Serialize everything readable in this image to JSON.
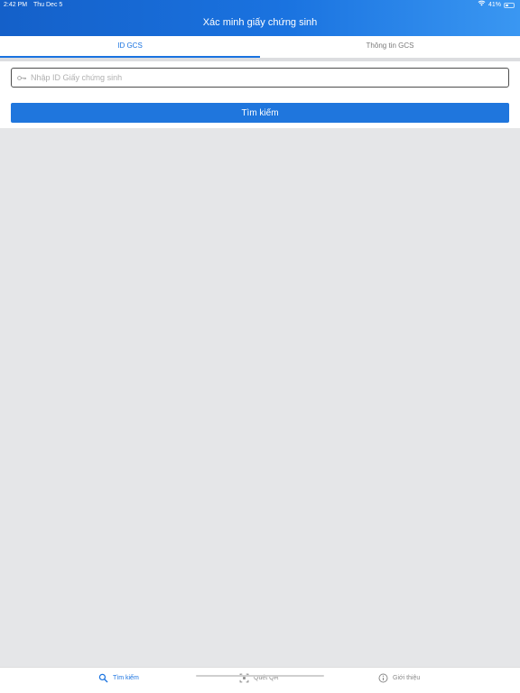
{
  "status_bar": {
    "time": "2:42 PM",
    "date": "Thu Dec 5",
    "battery": "41%",
    "battery_level": 0.41,
    "wifi_icon": "wifi-icon"
  },
  "header": {
    "title": "Xác minh giấy chứng sinh",
    "gradient": [
      "#1460c9",
      "#3a97f2"
    ]
  },
  "tabs": [
    {
      "label": "ID GCS",
      "active": true
    },
    {
      "label": "Thông tin GCS",
      "active": false
    }
  ],
  "search": {
    "placeholder": "Nhập ID Giấy chứng sinh",
    "value": "",
    "icon": "key-icon",
    "button_label": "Tìm kiếm"
  },
  "bottom_nav": [
    {
      "label": "Tìm kiếm",
      "icon": "search-icon",
      "active": true
    },
    {
      "label": "Quét QR",
      "icon": "qr-scan-icon",
      "active": false
    },
    {
      "label": "Giới thiệu",
      "icon": "info-icon",
      "active": false
    }
  ],
  "colors": {
    "accent": "#1a73e0",
    "button": "#1f76dd",
    "background": "#e5e6e8"
  }
}
